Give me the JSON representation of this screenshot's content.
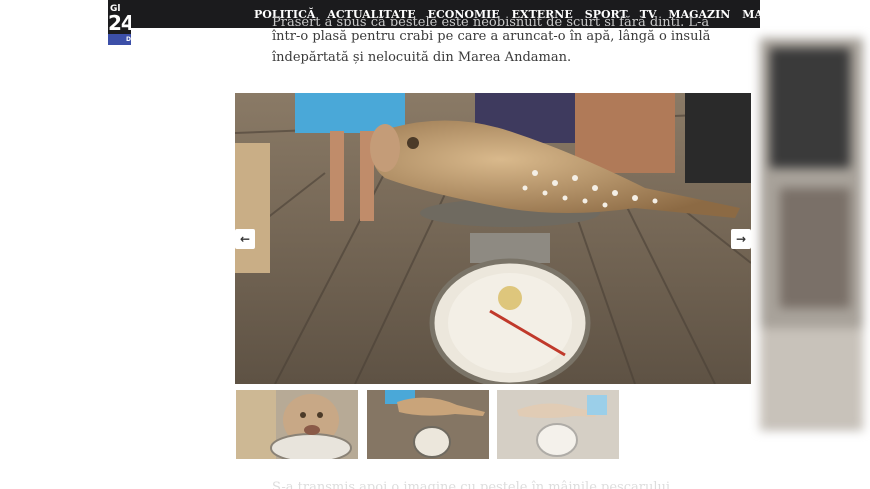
{
  "logo": {
    "line1": "Gl",
    "line2": "24",
    "line3": "D"
  },
  "nav": {
    "items": [
      "POLITICĂ",
      "ACTUALITATE",
      "ECONOMIE",
      "EXTERNE",
      "SPORT",
      "TV",
      "MAGAZIN"
    ],
    "more_label": "MAI MULTE"
  },
  "article": {
    "faded_line": "Prasert a spus că peștele este neobișnuit de scurt și fără dinți. L-a prins",
    "line2": "într-o plasă pentru crabi pe care a aruncat-o în apă, lângă o insulă",
    "line3": "îndepărtată și nelocuită din Marea Andaman.",
    "bottom_faded": "S-a transmis apoi o imagine cu peștele în mâinile pescarului"
  },
  "gallery": {
    "prev_icon": "arrow-left-icon",
    "next_icon": "arrow-right-icon",
    "prev_glyph": "←",
    "next_glyph": "→",
    "thumbnail_count": 3
  },
  "colors": {
    "topbar": "#1b1b1d",
    "accent_blue": "#3c4fa8",
    "text": "#3a3a3a"
  }
}
